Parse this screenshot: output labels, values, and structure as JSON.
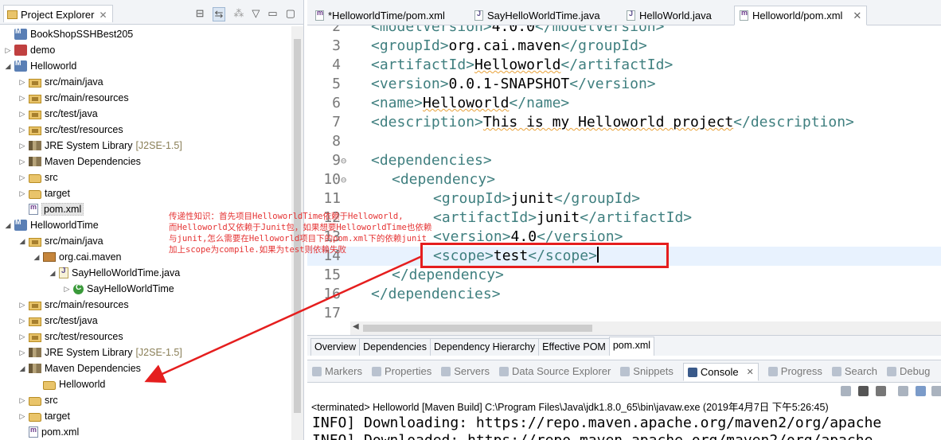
{
  "explorer": {
    "title": "Project Explorer",
    "rows": [
      {
        "indent": 0,
        "twisty": "",
        "icon": "proj",
        "label": "BookShopSSHBest205",
        "deco": ""
      },
      {
        "indent": 0,
        "twisty": "▷",
        "icon": "projerr",
        "label": "demo",
        "deco": ""
      },
      {
        "indent": 0,
        "twisty": "◢",
        "icon": "proj",
        "label": "Helloworld",
        "deco": ""
      },
      {
        "indent": 1,
        "twisty": "▷",
        "icon": "srcfolder",
        "label": "src/main/java",
        "deco": ""
      },
      {
        "indent": 1,
        "twisty": "▷",
        "icon": "srcfolder",
        "label": "src/main/resources",
        "deco": ""
      },
      {
        "indent": 1,
        "twisty": "▷",
        "icon": "srcfolder",
        "label": "src/test/java",
        "deco": ""
      },
      {
        "indent": 1,
        "twisty": "▷",
        "icon": "srcfolder",
        "label": "src/test/resources",
        "deco": ""
      },
      {
        "indent": 1,
        "twisty": "▷",
        "icon": "lib",
        "label": "JRE System Library",
        "deco": "[J2SE-1.5]"
      },
      {
        "indent": 1,
        "twisty": "▷",
        "icon": "lib",
        "label": "Maven Dependencies",
        "deco": ""
      },
      {
        "indent": 1,
        "twisty": "▷",
        "icon": "folder",
        "label": "src",
        "deco": ""
      },
      {
        "indent": 1,
        "twisty": "▷",
        "icon": "folder",
        "label": "target",
        "deco": ""
      },
      {
        "indent": 1,
        "twisty": "",
        "icon": "xml",
        "label": "pom.xml",
        "deco": "",
        "selected": true
      },
      {
        "indent": 0,
        "twisty": "◢",
        "icon": "proj",
        "label": "HelloworldTime",
        "deco": ""
      },
      {
        "indent": 1,
        "twisty": "◢",
        "icon": "srcfolder",
        "label": "src/main/java",
        "deco": ""
      },
      {
        "indent": 2,
        "twisty": "◢",
        "icon": "pkg",
        "label": "org.cai.maven",
        "deco": ""
      },
      {
        "indent": 3,
        "twisty": "◢",
        "icon": "java",
        "label": "SayHelloWorldTime.java",
        "deco": ""
      },
      {
        "indent": 4,
        "twisty": "▷",
        "icon": "cls",
        "label": "SayHelloWorldTime",
        "deco": ""
      },
      {
        "indent": 1,
        "twisty": "▷",
        "icon": "srcfolder",
        "label": "src/main/resources",
        "deco": ""
      },
      {
        "indent": 1,
        "twisty": "▷",
        "icon": "srcfolder",
        "label": "src/test/java",
        "deco": ""
      },
      {
        "indent": 1,
        "twisty": "▷",
        "icon": "srcfolder",
        "label": "src/test/resources",
        "deco": ""
      },
      {
        "indent": 1,
        "twisty": "▷",
        "icon": "lib",
        "label": "JRE System Library",
        "deco": "[J2SE-1.5]"
      },
      {
        "indent": 1,
        "twisty": "◢",
        "icon": "lib",
        "label": "Maven Dependencies",
        "deco": ""
      },
      {
        "indent": 2,
        "twisty": "",
        "icon": "folder",
        "label": "Helloworld",
        "deco": ""
      },
      {
        "indent": 1,
        "twisty": "▷",
        "icon": "folder",
        "label": "src",
        "deco": ""
      },
      {
        "indent": 1,
        "twisty": "▷",
        "icon": "folder",
        "label": "target",
        "deco": ""
      },
      {
        "indent": 1,
        "twisty": "",
        "icon": "xml",
        "label": "pom.xml",
        "deco": ""
      }
    ]
  },
  "editor": {
    "tabs": [
      {
        "label": "*HelloworldTime/pom.xml",
        "icon": "m",
        "active": false
      },
      {
        "label": "SayHelloWorldTime.java",
        "icon": "j",
        "active": false
      },
      {
        "label": "HelloWorld.java",
        "icon": "j",
        "active": false
      },
      {
        "label": "Helloworld/pom.xml",
        "icon": "m",
        "active": true
      }
    ],
    "lines": [
      {
        "n": "2",
        "indent": 0,
        "open": "<modelVersion>",
        "text": "4.0.0",
        "close": "</modelVersion>"
      },
      {
        "n": "3",
        "indent": 0,
        "open": "<groupId>",
        "text": "org.cai.maven",
        "close": "</groupId>"
      },
      {
        "n": "4",
        "indent": 0,
        "open": "<artifactId>",
        "text": "Helloworld",
        "close": "</artifactId>",
        "squig": true
      },
      {
        "n": "5",
        "indent": 0,
        "open": "<version>",
        "text": "0.0.1-SNAPSHOT",
        "close": "</version>"
      },
      {
        "n": "6",
        "indent": 0,
        "open": "<name>",
        "text": "Helloworld",
        "close": "</name>",
        "squig": true
      },
      {
        "n": "7",
        "indent": 0,
        "open": "<description>",
        "text": "This is my Helloworld project",
        "close": "</description>",
        "squig": true
      },
      {
        "n": "8",
        "indent": 0,
        "open": "",
        "text": "",
        "close": ""
      },
      {
        "n": "9",
        "indent": 0,
        "open": "<dependencies>",
        "text": "",
        "close": "",
        "fold": "⊖"
      },
      {
        "n": "10",
        "indent": 1,
        "open": "<dependency>",
        "text": "",
        "close": "",
        "fold": "⊖"
      },
      {
        "n": "11",
        "indent": 3,
        "open": "<groupId>",
        "text": "junit",
        "close": "</groupId>"
      },
      {
        "n": "12",
        "indent": 3,
        "open": "<artifactId>",
        "text": "junit",
        "close": "</artifactId>"
      },
      {
        "n": "13",
        "indent": 3,
        "open": "<version>",
        "text": "4.0",
        "close": "</version>"
      },
      {
        "n": "14",
        "indent": 3,
        "open": "<scope>",
        "text": "test",
        "close": "</scope>",
        "current": true
      },
      {
        "n": "15",
        "indent": 1,
        "open": "</dependency>",
        "text": "",
        "close": ""
      },
      {
        "n": "16",
        "indent": 0,
        "open": "</dependencies>",
        "text": "",
        "close": ""
      },
      {
        "n": "17",
        "indent": 0,
        "open": "",
        "text": "",
        "close": ""
      }
    ],
    "bottom_tabs": [
      "Overview",
      "Dependencies",
      "Dependency Hierarchy",
      "Effective POM",
      "pom.xml"
    ],
    "active_bottom_tab": 4
  },
  "console": {
    "tabs": [
      "Markers",
      "Properties",
      "Servers",
      "Data Source Explorer",
      "Snippets",
      "Console",
      "Progress",
      "Search",
      "Debug"
    ],
    "active_tab": 5,
    "status": "<terminated> Helloworld [Maven Build] C:\\Program Files\\Java\\jdk1.8.0_65\\bin\\javaw.exe (2019年4月7日 下午5:26:45)",
    "lines": [
      "INFO] Downloading: https://repo.maven.apache.org/maven2/org/apache",
      "INFO] Downloaded: https://repo.maven.apache.org/maven2/org/apache"
    ]
  },
  "annotation": {
    "note_lines": [
      "传递性知识：首先项目HelloworldTime依赖于Helloworld,",
      "而Helloworld又依赖于Junit包，如果想要HelloworldTime也依赖",
      "与junit,怎么需要在Helloworld项目下的pom.xml下的依赖junit",
      "加上scope为compile.如果为test则依赖失败"
    ],
    "color": "#e53333"
  }
}
